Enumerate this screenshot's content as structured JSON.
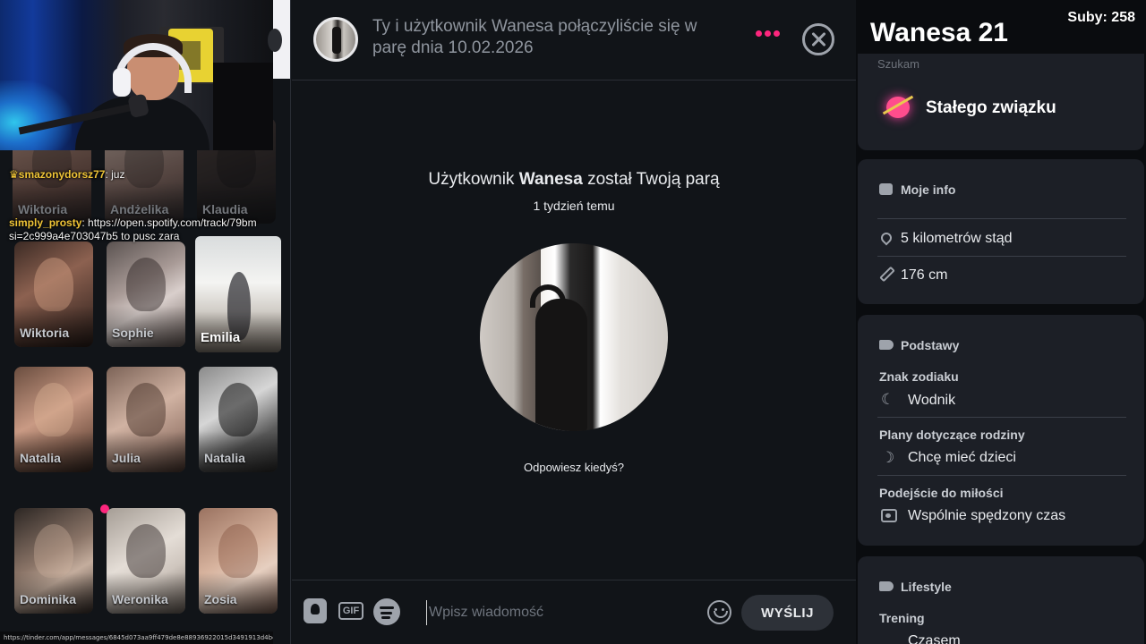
{
  "left": {
    "chat": [
      {
        "user": "smazonydorsz77",
        "message": ": juz"
      },
      {
        "user": "simply_prosty",
        "message": ": https://open.spotify.com/track/79bm"
      },
      {
        "user": "",
        "message": "si=2c999a4e703047b5 to pusc zara"
      }
    ],
    "match_cards": [
      {
        "name": "Wiktoria",
        "dim": true
      },
      {
        "name": "Andżelika",
        "dim": true
      },
      {
        "name": "Klaudia",
        "dim": true
      },
      {
        "name": "Wiktoria"
      },
      {
        "name": "Sophie"
      },
      {
        "name": "Emilia",
        "highlighted": true
      },
      {
        "name": "Natalia"
      },
      {
        "name": "Julia"
      },
      {
        "name": "Natalia"
      },
      {
        "name": "Dominika",
        "unread": true
      },
      {
        "name": "Weronika"
      },
      {
        "name": "Zosia"
      }
    ],
    "status_url": "https://tinder.com/app/messages/6845d073aa9ff479de8e88936922015d3491913d4b4dbd84"
  },
  "conversation": {
    "header_text": "Ty i użytkownik Wanesa połączyliście się w parę dnia 10.02.2026",
    "match_title_prefix": "Użytkownik ",
    "match_name": "Wanesa",
    "match_title_suffix": " został Twoją parą",
    "match_time": "1 tydzień temu",
    "prompt": "Odpowiesz kiedyś?",
    "composer": {
      "gif_label": "GIF",
      "placeholder": "Wpisz wiadomość",
      "send_label": "WYŚLIJ"
    }
  },
  "profile": {
    "name_age": "Wanesa 21",
    "subs_label": "Suby: 258",
    "looking_for_header": "Szukam",
    "looking_for": "Stałego związku",
    "my_info_title": "Moje info",
    "distance": "5 kilometrów stąd",
    "height": "176 cm",
    "basics_title": "Podstawy",
    "zodiac_label": "Znak zodiaku",
    "zodiac_value": "Wodnik",
    "family_label": "Plany dotyczące rodziny",
    "family_value": "Chcę mieć dzieci",
    "love_label": "Podejście do miłości",
    "love_value": "Wspólnie spędzony czas",
    "lifestyle_title": "Lifestyle",
    "workout_label": "Trening",
    "workout_value": "Czasem"
  },
  "colors": {
    "accent": "#fd267d",
    "background": "#111418",
    "panel": "#1c1f26",
    "chat_username": "#f0c537"
  }
}
